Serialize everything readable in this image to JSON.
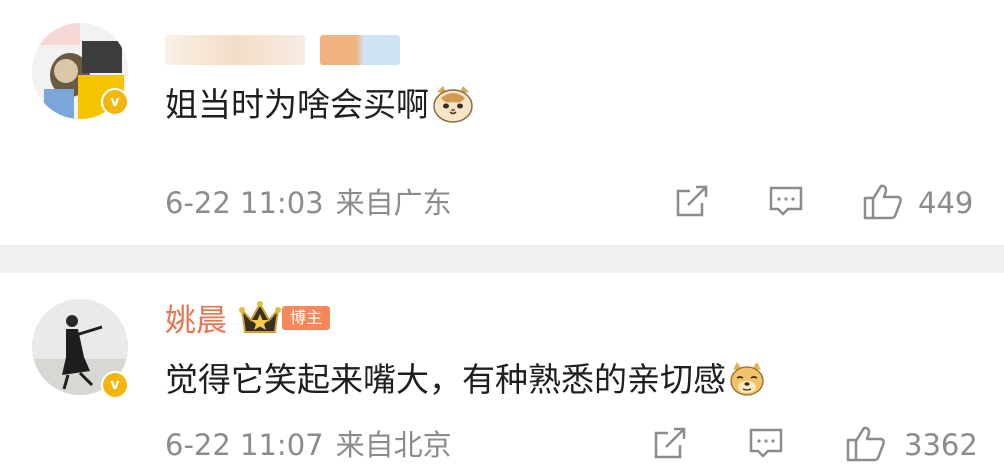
{
  "comments": [
    {
      "username": "",
      "content": "姐当时为啥会买啊",
      "emoji": "cat-face-emoji",
      "time": "6-22 11:03",
      "location": "来自广东",
      "likes": "449",
      "verified": true
    },
    {
      "username": "姚晨",
      "badge": "博主",
      "content": "觉得它笑起来嘴大，有种熟悉的亲切感",
      "emoji": "doge-emoji",
      "time": "6-22 11:07",
      "location": "来自北京",
      "likes": "3362",
      "verified": true
    }
  ],
  "colors": {
    "username": "#eb7350",
    "meta": "#8c8c8c",
    "verify": "#f3b60f",
    "badge": "#f7885c"
  },
  "icons": [
    "share-icon",
    "comment-icon",
    "like-icon",
    "crown-icon",
    "verified-icon"
  ]
}
